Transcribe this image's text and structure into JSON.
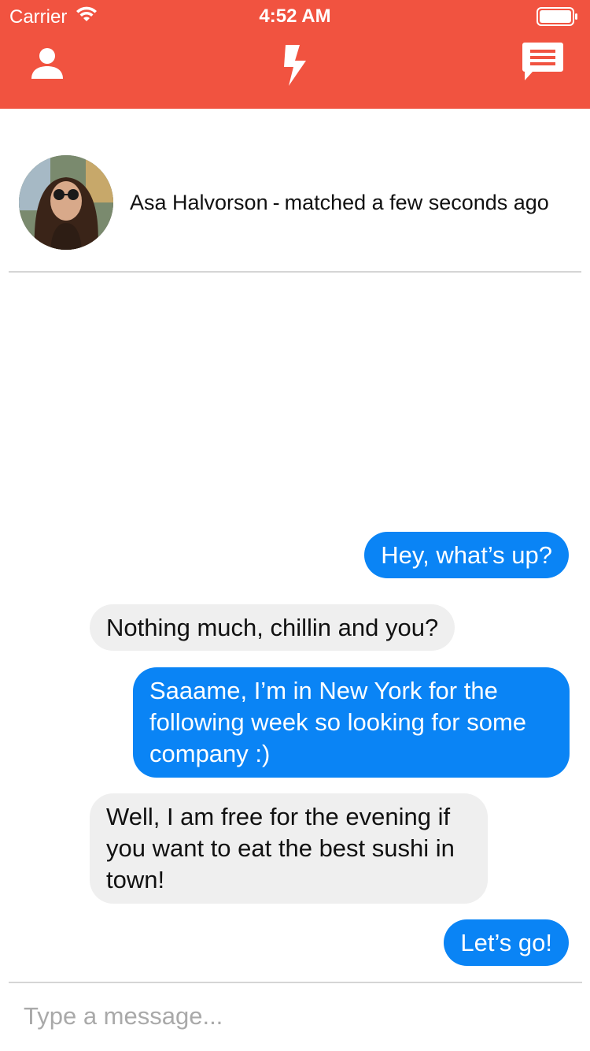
{
  "status_bar": {
    "carrier": "Carrier",
    "time": "4:52 AM",
    "wifi_icon": "wifi-icon",
    "battery_icon": "battery-icon"
  },
  "nav": {
    "profile_icon": "person-icon",
    "flash_icon": "lightning-icon",
    "messages_icon": "chat-bubble-icon"
  },
  "match": {
    "name": "Asa Halvorson",
    "separator": "-",
    "status": "matched a few seconds ago"
  },
  "messages": [
    {
      "from": "me",
      "text": "Hey, what’s up?"
    },
    {
      "from": "them",
      "text": "Nothing much, chillin and you?"
    },
    {
      "from": "me",
      "text": "Saaame, I’m in New York for the following week so looking for some company :)"
    },
    {
      "from": "them",
      "text": "Well, I am free for the evening if you want to eat the best sushi in town!"
    },
    {
      "from": "me",
      "text": "Let’s go!"
    }
  ],
  "composer": {
    "placeholder": "Type a message...",
    "value": ""
  },
  "colors": {
    "header": "#f15340",
    "outgoing_bubble": "#0a84f5",
    "incoming_bubble": "#efefef"
  }
}
